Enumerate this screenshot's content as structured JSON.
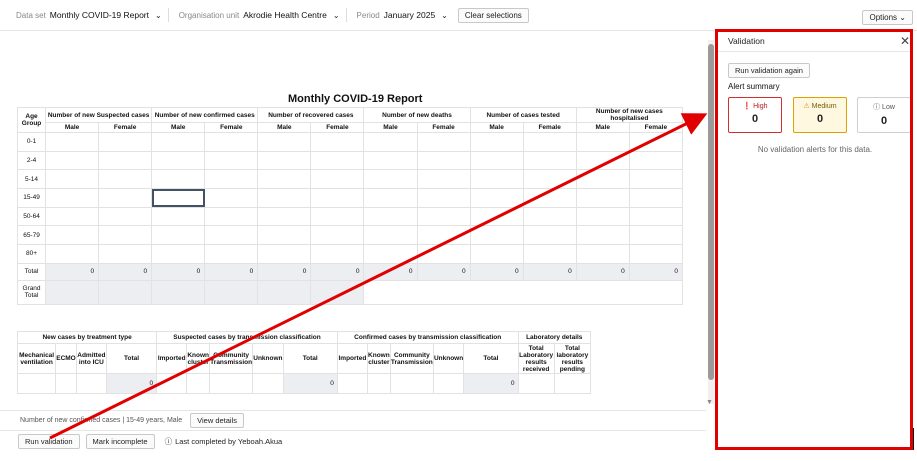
{
  "topbar": {
    "dataset_key": "Data set",
    "dataset_value": "Monthly COVID-19 Report",
    "orgunit_key": "Organisation unit",
    "orgunit_value": "Akrodie Health Centre",
    "period_key": "Period",
    "period_value": "January 2025",
    "clear_label": "Clear selections",
    "options_label": "Options"
  },
  "form": {
    "title": "Monthly COVID-19 Report",
    "age_group_header": "Age Group",
    "section_headers": [
      "Number of new Suspected cases",
      "Number of new confirmed cases",
      "Number of recovered cases",
      "Number of new deaths",
      "Number of cases tested",
      "Number of new cases hospitalised"
    ],
    "male": "Male",
    "female": "Female",
    "age_rows": [
      "0-1",
      "2-4",
      "5-14",
      "15-49",
      "50-64",
      "65-79",
      "80+"
    ],
    "total_label": "Total",
    "grand_total_label": "Grand Total",
    "totals": [
      "0",
      "0",
      "0",
      "0",
      "0",
      "0",
      "0",
      "0",
      "0",
      "0",
      "0",
      "0"
    ]
  },
  "form2": {
    "groups": [
      "New cases by treatment type",
      "Suspected cases by transmission classification",
      "Confirmed cases by transmission classification",
      "Laboratory details"
    ],
    "cols": [
      "Mechanical ventilation",
      "ECMO",
      "Admitted into ICU",
      "Total",
      "Imported",
      "Known cluster",
      "Community Transmission",
      "Unknown",
      "Total",
      "Imported",
      "Known cluster",
      "Community Transmission",
      "Unknown",
      "Total",
      "Total Laboratory results received",
      "Total laboratory results pending"
    ],
    "total_values": [
      "0",
      "0",
      "0"
    ]
  },
  "footer": {
    "selected_cell": "Number of new confirmed cases | 15-49 years, Male",
    "view_details": "View details",
    "run_validation": "Run validation",
    "mark_incomplete": "Mark incomplete",
    "last_completed": "Last completed by Yeboah.Akua"
  },
  "validation_panel": {
    "title": "Validation",
    "run_again": "Run validation again",
    "alert_summary": "Alert summary",
    "high_label": "High",
    "high_count": "0",
    "medium_label": "Medium",
    "medium_count": "0",
    "low_label": "Low",
    "low_count": "0",
    "empty_message": "No validation alerts for this data."
  },
  "colors": {
    "annotation_red": "#e00000",
    "high": "#d32f2f",
    "medium": "#e0a000",
    "total_cell_bg": "#eceef2"
  }
}
